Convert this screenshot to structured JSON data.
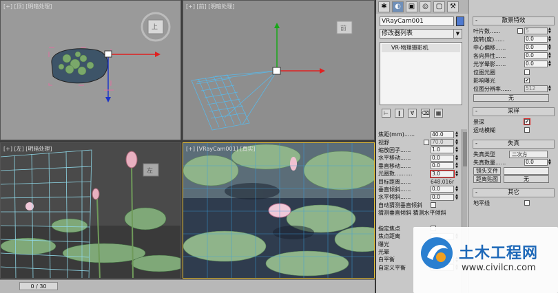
{
  "viewports": {
    "top_label": "[+] [顶] [明暗处理]",
    "front_label": "[+] [前] [明暗处理]",
    "left_label": "[+] [左] [明暗处理]",
    "camera_label": "[+] [VRayCam001] [真实]",
    "viewcube_top": "上",
    "viewcube_front": "前",
    "viewcube_left": "左"
  },
  "timeline": {
    "slider": "0 / 30"
  },
  "command_panel": {
    "object_name": "VRayCam001",
    "object_color": "#4f7ad0",
    "modifier_list": "修改器列表",
    "stack_item": "VR-物理摄影机",
    "params": [
      {
        "label": "焦距(mm)......",
        "value": "40.0"
      },
      {
        "label": "视野",
        "value": "70.0",
        "check": true
      },
      {
        "label": "缩放因子......",
        "value": "1.0"
      },
      {
        "label": "水平移动......",
        "value": "0.0"
      },
      {
        "label": "垂直移动......",
        "value": "0.0"
      },
      {
        "label": "光圈数..........",
        "value": "3.0",
        "highlight": true
      },
      {
        "label": "目标距离......",
        "readout": "648.016r"
      },
      {
        "label": "垂直倾斜......",
        "value": "0.0"
      },
      {
        "label": "水平倾斜......",
        "value": "0.0"
      },
      {
        "label": "自动猜测垂直倾斜",
        "check": false
      },
      {
        "label": "猜测垂直倾斜 猜测水平倾斜",
        "plain": true
      },
      {
        "label": "",
        "plain": true
      },
      {
        "label": "指定焦点",
        "check": false
      },
      {
        "label": "焦点距离",
        "value": ""
      },
      {
        "label": "曝光",
        "check": true
      },
      {
        "label": "光晕",
        "check": true
      },
      {
        "label": "白平衡",
        "value": ""
      },
      {
        "label": "自定义平衡",
        "value": ""
      }
    ]
  },
  "right_rollouts": {
    "bokeh": {
      "title": "散景特效",
      "rows": [
        {
          "label": "叶片数......",
          "value": "5",
          "check": true,
          "gray": true
        },
        {
          "label": "旋转(度)......",
          "value": "0.0"
        },
        {
          "label": "中心偏移......",
          "value": "0.0"
        },
        {
          "label": "各向异性......",
          "value": "0.0"
        },
        {
          "label": "光学晕影......",
          "value": "0.0"
        },
        {
          "label": "位图光圈",
          "check": true
        },
        {
          "label": "影响曝光",
          "check": true,
          "checked": true
        },
        {
          "label": "位图分辨率......",
          "value": "512",
          "gray": true
        }
      ],
      "button": "无"
    },
    "sampling": {
      "title": "采样",
      "rows": [
        {
          "label": "景深",
          "check": true,
          "checked": true,
          "highlight": true
        },
        {
          "label": "运动模糊",
          "check": true
        }
      ]
    },
    "distortion": {
      "title": "失真",
      "type_label": "失真类型",
      "type_value": "二次方",
      "amount_label": "失真数量......",
      "amount_value": "0.0",
      "file_label": "镜头文件",
      "map_label": "距离贴图",
      "map_button": "无"
    },
    "misc": {
      "title": "其它",
      "row": "地平线"
    }
  },
  "watermark": {
    "title": "土木工程网",
    "url": "www.civilcn.com"
  }
}
